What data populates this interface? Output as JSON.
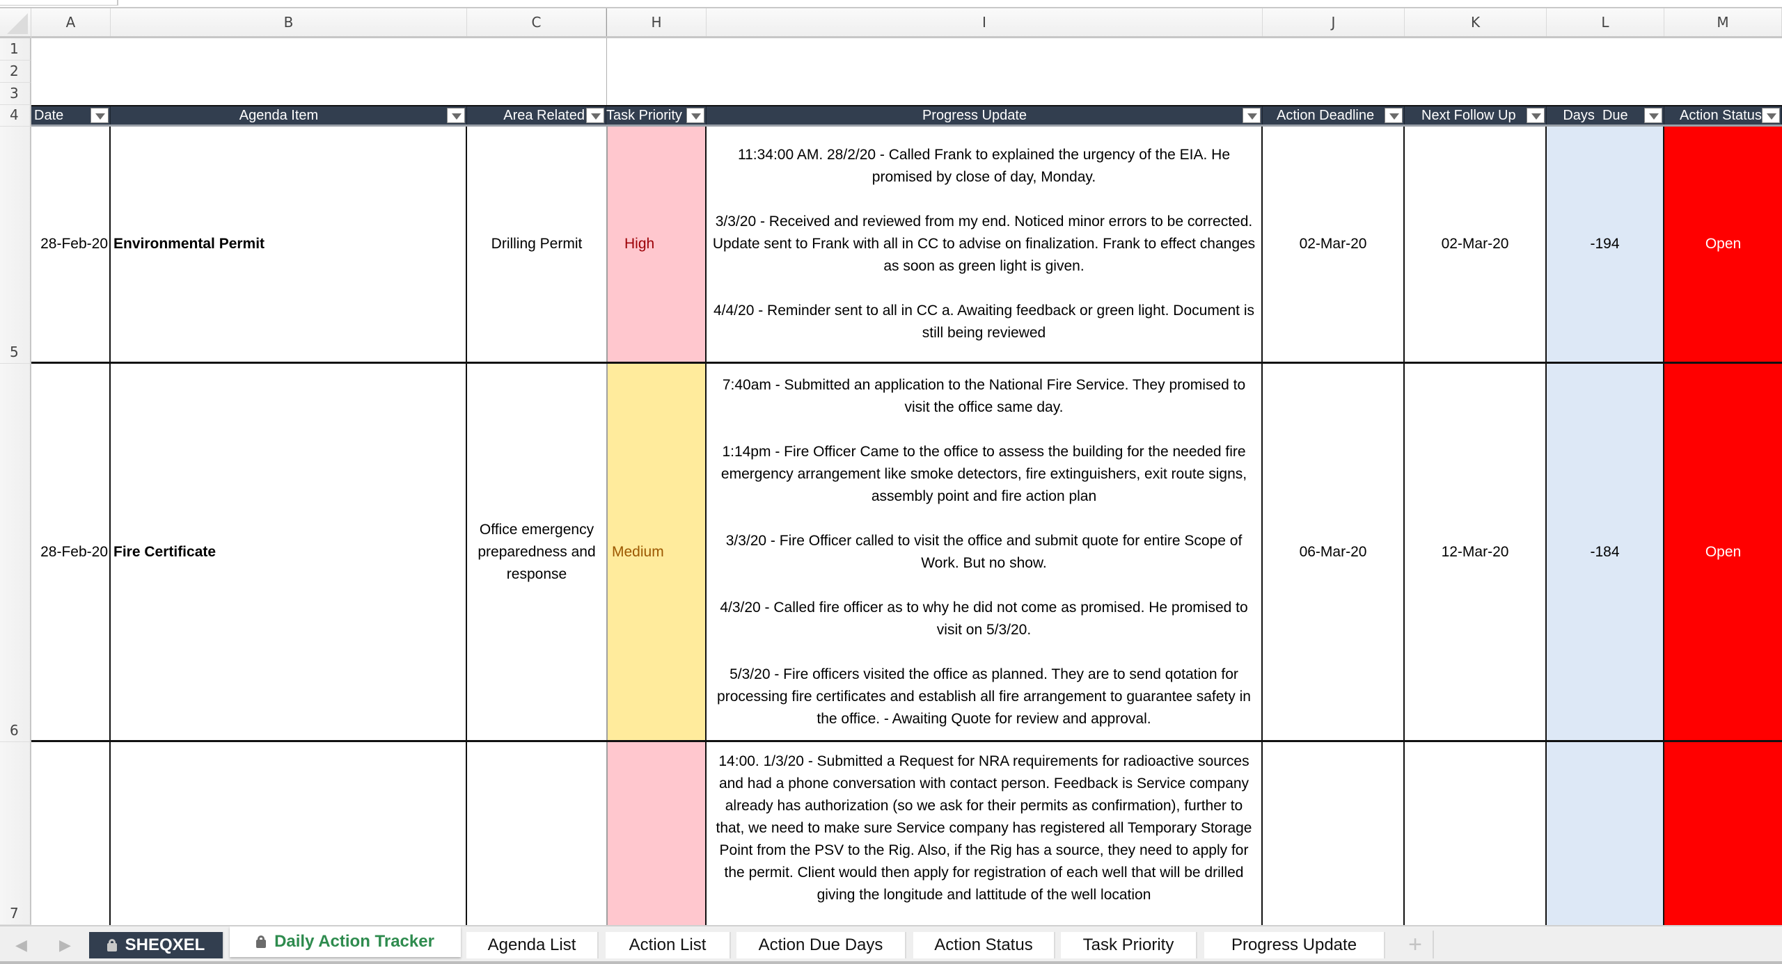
{
  "columns": [
    "A",
    "B",
    "C",
    "H",
    "I",
    "J",
    "K",
    "L",
    "M"
  ],
  "row_numbers": [
    "1",
    "2",
    "3",
    "4",
    "5",
    "6",
    "7"
  ],
  "table": {
    "headers": {
      "date": "Date",
      "agenda_item": "Agenda Item",
      "area_related": "Area Related",
      "task_priority": "Task Priority",
      "progress_update": "Progress Update",
      "action_deadline": "Action Deadline",
      "next_follow_up": "Next Follow Up",
      "days_due": "Days  Due",
      "action_status": "Action Status"
    },
    "rows": [
      {
        "date": "28-Feb-20",
        "agenda_item": "Environmental Permit",
        "area_related": "Drilling Permit",
        "task_priority": "High",
        "progress_update": "11:34:00 AM. 28/2/20 - Called Frank to explained the urgency of the EIA. He promised by close of day, Monday.\n\n3/3/20 - Received and reviewed from my end. Noticed minor errors to be corrected. Update sent to Frank with all in CC to advise on finalization.  Frank to effect changes as soon as green light is given.\n\n4/4/20 - Reminder sent to all in CC a. Awaiting feedback or green light. Document is still being reviewed",
        "action_deadline": "02-Mar-20",
        "next_follow_up": "02-Mar-20",
        "days_due": "-194",
        "action_status": "Open"
      },
      {
        "date": "28-Feb-20",
        "agenda_item": "Fire Certificate",
        "area_related": "Office emergency preparedness and response",
        "task_priority": "Medium",
        "progress_update": "7:40am - Submitted an application to the National Fire Service. They promised to visit the office same day.\n\n1:14pm - Fire Officer Came to the office to assess the building for the needed fire emergency arrangement like smoke detectors, fire extinguishers, exit route signs, assembly point and fire action plan\n\n3/3/20 - Fire Officer called to visit the office and submit quote for entire Scope of Work. But no show.\n\n4/3/20 - Called fire officer as to why he did not come as promised. He promised to visit on 5/3/20.\n\n5/3/20 - Fire officers visited the office as planned. They are to send qotation for processing fire certificates and establish all fire arrangement to guarantee safety in the office. - Awaiting Quote for review and approval.",
        "action_deadline": "06-Mar-20",
        "next_follow_up": "12-Mar-20",
        "days_due": "-184",
        "action_status": "Open"
      },
      {
        "date": "",
        "agenda_item": "",
        "area_related": "",
        "task_priority": "",
        "progress_update": "14:00. 1/3/20 - Submitted a Request for NRA requirements for radioactive sources and had a phone conversation with contact person. Feedback is Service company already has authorization (so we ask for their permits as confirmation), further to that, we need to make sure Service company has registered all Temporary Storage Point from the PSV to the Rig. Also, if the Rig has a source, they need to apply for the permit. Client would then apply for registration of each well that will be drilled giving the longitude and lattitude of the well location",
        "action_deadline": "",
        "next_follow_up": "",
        "days_due": "",
        "action_status": ""
      }
    ]
  },
  "colors": {
    "header_bg": "#323e4f",
    "priority_high_bg": "#ffc7ce",
    "priority_high_text": "#9c0006",
    "priority_medium_bg": "#ffeb9c",
    "priority_medium_text": "#9c5700",
    "days_due_bg": "#dde8f6",
    "status_open_bg": "#ff0000",
    "active_tab_text": "#2e8b4e"
  },
  "sheet_tabs": [
    {
      "label": "SHEQXEL",
      "locked": true
    },
    {
      "label": "Daily Action Tracker",
      "locked": true,
      "active": true
    },
    {
      "label": "Agenda List"
    },
    {
      "label": "Action List"
    },
    {
      "label": "Action Due Days"
    },
    {
      "label": "Action Status"
    },
    {
      "label": "Task Priority"
    },
    {
      "label": "Progress Update"
    }
  ],
  "add_sheet_label": "+",
  "nav_arrows": "◀ ▶"
}
